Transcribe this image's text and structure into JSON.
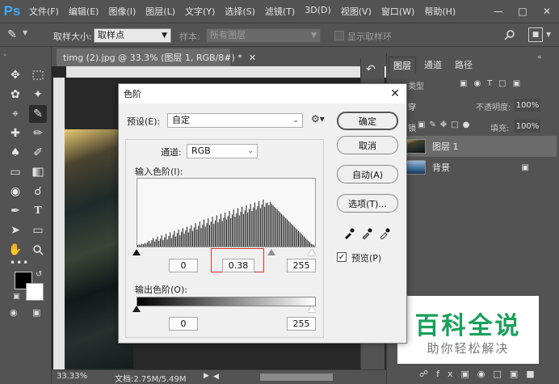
{
  "app": {
    "logo": "Ps",
    "menu": [
      "文件(F)",
      "编辑(E)",
      "图像(I)",
      "图层(L)",
      "文字(Y)",
      "选择(S)",
      "滤镜(T)",
      "3D(D)",
      "视图(V)",
      "窗口(W)",
      "帮助(H)"
    ]
  },
  "options": {
    "sample_size_label": "取样大小:",
    "sample_size_value": "取样点",
    "sample_label": "样本:",
    "sample_value": "所有图层",
    "show_ring_label": "显示取样环"
  },
  "document": {
    "tab_title": "timg (2).jpg @ 33.3% (图层 1, RGB/8#) *",
    "zoom": "33.33%",
    "doc_size": "文档:2.75M/5.49M"
  },
  "layers_panel": {
    "tabs": [
      "图层",
      "通道",
      "路径"
    ],
    "kind_label": "类型",
    "mode_label": "穿",
    "opacity_label": "不透明度:",
    "opacity_value": "100%",
    "lock_label": "锁",
    "fill_label": "填充:",
    "fill_value": "100%",
    "layers": [
      {
        "name": "图层 1"
      },
      {
        "name": "背景"
      }
    ]
  },
  "dialog": {
    "title": "色阶",
    "preset_label": "预设(E):",
    "preset_value": "自定",
    "channel_label": "通道:",
    "channel_value": "RGB",
    "input_levels_label": "输入色阶(I):",
    "input_black": "0",
    "input_gamma": "0.38",
    "input_white": "255",
    "output_levels_label": "输出色阶(O):",
    "output_black": "0",
    "output_white": "255",
    "buttons": {
      "ok": "确定",
      "cancel": "取消",
      "auto": "自动(A)",
      "options": "选项(T)..."
    },
    "preview_label": "预览(P)",
    "preview_checked": true,
    "histogram": [
      2,
      3,
      2,
      4,
      3,
      5,
      4,
      6,
      8,
      5,
      9,
      12,
      7,
      10,
      14,
      8,
      11,
      16,
      9,
      13,
      18,
      10,
      15,
      20,
      12,
      17,
      22,
      14,
      19,
      24,
      16,
      21,
      26,
      18,
      23,
      28,
      20,
      25,
      30,
      22,
      27,
      33,
      24,
      29,
      35,
      26,
      31,
      38,
      28,
      33,
      40,
      30,
      35,
      42,
      32,
      37,
      44,
      34,
      39,
      46,
      36,
      41,
      48,
      38,
      43,
      50,
      40,
      45,
      52,
      42,
      47,
      54,
      44,
      49,
      56,
      46,
      51,
      58,
      48,
      53,
      60,
      50,
      55,
      62,
      52,
      57,
      64,
      54,
      59,
      66,
      56,
      61,
      62,
      58,
      63,
      60,
      58,
      56,
      54,
      52,
      50,
      48,
      46,
      44,
      42,
      40,
      38,
      36,
      34,
      32,
      30,
      28,
      26,
      24,
      22,
      20,
      18,
      16,
      14,
      12,
      10,
      8,
      6,
      4,
      3,
      2
    ]
  },
  "watermark": {
    "title": "百科全说",
    "subtitle": "助你轻松解决"
  }
}
